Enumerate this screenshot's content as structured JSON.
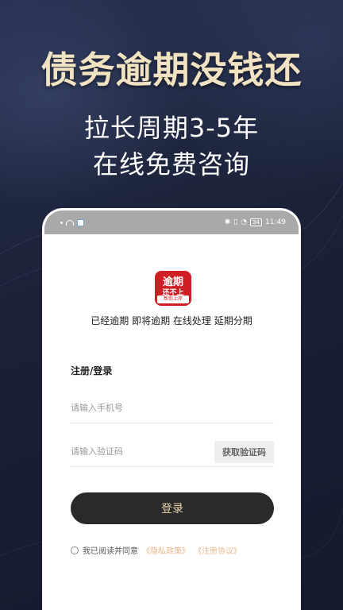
{
  "promo": {
    "headline": "债务逾期没钱还",
    "line1": "拉长周期3-5年",
    "line2": "在线免费咨询"
  },
  "statusbar": {
    "battery": "34",
    "time": "11:49"
  },
  "app": {
    "logo_line1": "逾期",
    "logo_line2": "还不上",
    "logo_line3": "帮你上岸",
    "tagline": "已经逾期 即将逾期 在线处理 延期分期"
  },
  "form": {
    "title": "注册/登录",
    "phone_placeholder": "请输入手机号",
    "code_placeholder": "请输入验证码",
    "get_code_label": "获取验证码",
    "login_label": "登录",
    "agree_text": "我已阅读并同意",
    "privacy_link": "《隐私政策》",
    "terms_link": "《注册协议》"
  },
  "colors": {
    "background": "#1b2237",
    "headline": "#f1e3c2",
    "logo": "#cf1f24",
    "login_button": "#2a2a2a",
    "login_text": "#e8d3a8",
    "link": "#e8b98a"
  }
}
